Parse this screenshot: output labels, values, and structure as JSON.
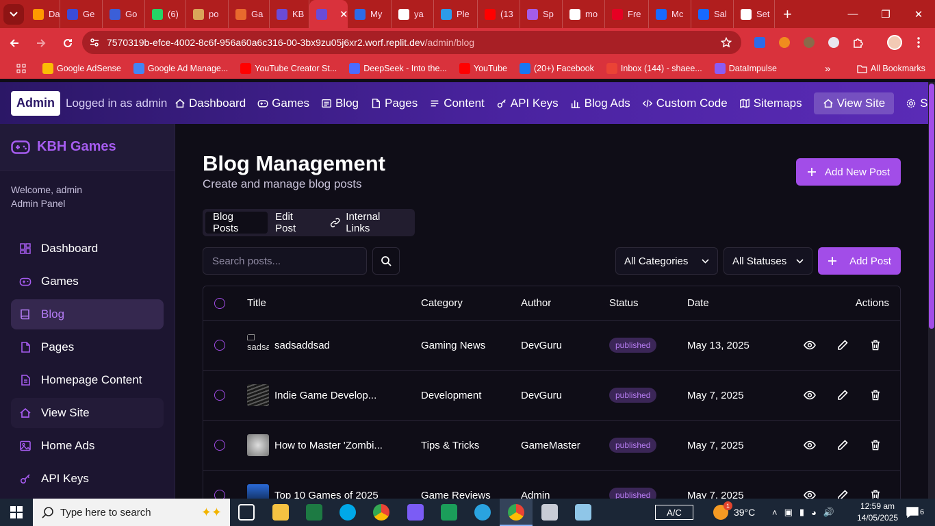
{
  "browser": {
    "tabs": [
      {
        "label": "Da",
        "icon": "amazon-icon",
        "color": "#ff9900"
      },
      {
        "label": "Ge",
        "icon": "gamepad-icon",
        "color": "#3b4bd8"
      },
      {
        "label": "Go",
        "icon": "shield-icon",
        "color": "#3b5fd8"
      },
      {
        "label": "(6)",
        "icon": "whatsapp-icon",
        "color": "#25d366"
      },
      {
        "label": "po",
        "icon": "poe-icon",
        "color": "#d9a65a"
      },
      {
        "label": "Ga",
        "icon": "grid-icon",
        "color": "#e86a2d"
      },
      {
        "label": "KB",
        "icon": "controller-icon",
        "color": "#6b4bd8"
      },
      {
        "label": "",
        "icon": "controller-icon",
        "color": "#6b4bd8",
        "active": true
      },
      {
        "label": "My",
        "icon": "link-icon",
        "color": "#2d6be8"
      },
      {
        "label": "ya",
        "icon": "google-icon",
        "color": "#ffffff"
      },
      {
        "label": "Ple",
        "icon": "plex-icon",
        "color": "#2d9be8"
      },
      {
        "label": "(13",
        "icon": "youtube-icon",
        "color": "#ff0000"
      },
      {
        "label": "Sp",
        "icon": "gemini-icon",
        "color": "#a45ce8"
      },
      {
        "label": "mo",
        "icon": "google-icon",
        "color": "#ffffff"
      },
      {
        "label": "Fre",
        "icon": "pinterest-icon",
        "color": "#e60023"
      },
      {
        "label": "Mc",
        "icon": "behance-icon",
        "color": "#1769ff"
      },
      {
        "label": "Sal",
        "icon": "behance-icon",
        "color": "#1769ff"
      },
      {
        "label": "Set",
        "icon": "settings-icon",
        "color": "#ffffff"
      }
    ],
    "url_host": "7570319b-efce-4002-8c6f-956a60a6c316-00-3bx9zu05j6xr2.worf.replit.dev",
    "url_path": "/admin/blog",
    "bookmarks": [
      {
        "label": "Google AdSense",
        "color": "#fbbc05"
      },
      {
        "label": "Google Ad Manage...",
        "color": "#4285f4"
      },
      {
        "label": "YouTube Creator St...",
        "color": "#ff0000"
      },
      {
        "label": "DeepSeek - Into the...",
        "color": "#4d6bfe"
      },
      {
        "label": "YouTube",
        "color": "#ff0000"
      },
      {
        "label": "(20+) Facebook",
        "color": "#1877f2"
      },
      {
        "label": "Inbox (144) - shaee...",
        "color": "#ea4335"
      },
      {
        "label": "DataImpulse",
        "color": "#8a5cf5"
      }
    ],
    "all_bookmarks": "All Bookmarks"
  },
  "header": {
    "badge": "Admin",
    "logged_in": "Logged in as admin",
    "nav": [
      {
        "label": "Dashboard",
        "icon": "home-icon"
      },
      {
        "label": "Games",
        "icon": "gamepad-icon"
      },
      {
        "label": "Blog",
        "icon": "newspaper-icon"
      },
      {
        "label": "Pages",
        "icon": "file-icon"
      },
      {
        "label": "Content",
        "icon": "list-icon"
      },
      {
        "label": "API Keys",
        "icon": "key-icon"
      },
      {
        "label": "Blog Ads",
        "icon": "bar-chart-icon"
      },
      {
        "label": "Custom Code",
        "icon": "code-icon"
      },
      {
        "label": "Sitemaps",
        "icon": "map-icon"
      },
      {
        "label": "View Site",
        "icon": "home-icon",
        "highlight": true
      },
      {
        "label": "Settings",
        "icon": "gear-icon"
      }
    ]
  },
  "sidebar": {
    "brand": "KBH Games",
    "welcome": "Welcome, admin",
    "panel": "Admin Panel",
    "items": [
      {
        "label": "Dashboard",
        "icon": "dashboard-icon"
      },
      {
        "label": "Games",
        "icon": "gamepad-icon"
      },
      {
        "label": "Blog",
        "icon": "book-icon",
        "active": true
      },
      {
        "label": "Pages",
        "icon": "file-icon"
      },
      {
        "label": "Homepage Content",
        "icon": "file-text-icon"
      },
      {
        "label": "View Site",
        "icon": "home-icon",
        "hover": true
      },
      {
        "label": "Home Ads",
        "icon": "image-icon"
      },
      {
        "label": "API Keys",
        "icon": "key-icon"
      }
    ]
  },
  "main": {
    "title": "Blog Management",
    "subtitle": "Create and manage blog posts",
    "add_new_post": "Add New Post",
    "tabs": [
      "Blog Posts",
      "Edit Post",
      "Internal Links"
    ],
    "search_placeholder": "Search posts...",
    "category_filter": "All Categories",
    "status_filter": "All Statuses",
    "add_post": "Add Post",
    "columns": [
      "Title",
      "Category",
      "Author",
      "Status",
      "Date",
      "Actions"
    ],
    "rows": [
      {
        "thumb_alt": "sadsa",
        "title": "sadsaddsad",
        "category": "Gaming News",
        "author": "DevGuru",
        "status": "published",
        "date": "May 13, 2025"
      },
      {
        "thumb_alt": "",
        "title": "Indie Game Develop...",
        "category": "Development",
        "author": "DevGuru",
        "status": "published",
        "date": "May 7, 2025"
      },
      {
        "thumb_alt": "",
        "title": "How to Master 'Zombi...",
        "category": "Tips & Tricks",
        "author": "GameMaster",
        "status": "published",
        "date": "May 7, 2025"
      },
      {
        "thumb_alt": "",
        "title": "Top 10 Games of 2025",
        "category": "Game Reviews",
        "author": "Admin",
        "status": "published",
        "date": "May 7, 2025"
      }
    ]
  },
  "taskbar": {
    "search_placeholder": "Type here to search",
    "ac": "A/C",
    "weather": "39°C",
    "time": "12:59 am",
    "date": "14/05/2025",
    "notifications": "6",
    "weather_badge": "1"
  },
  "colors": {
    "accent": "#a24de8",
    "tab_bar": "#b01e1e",
    "toolbar": "#d9323c"
  }
}
